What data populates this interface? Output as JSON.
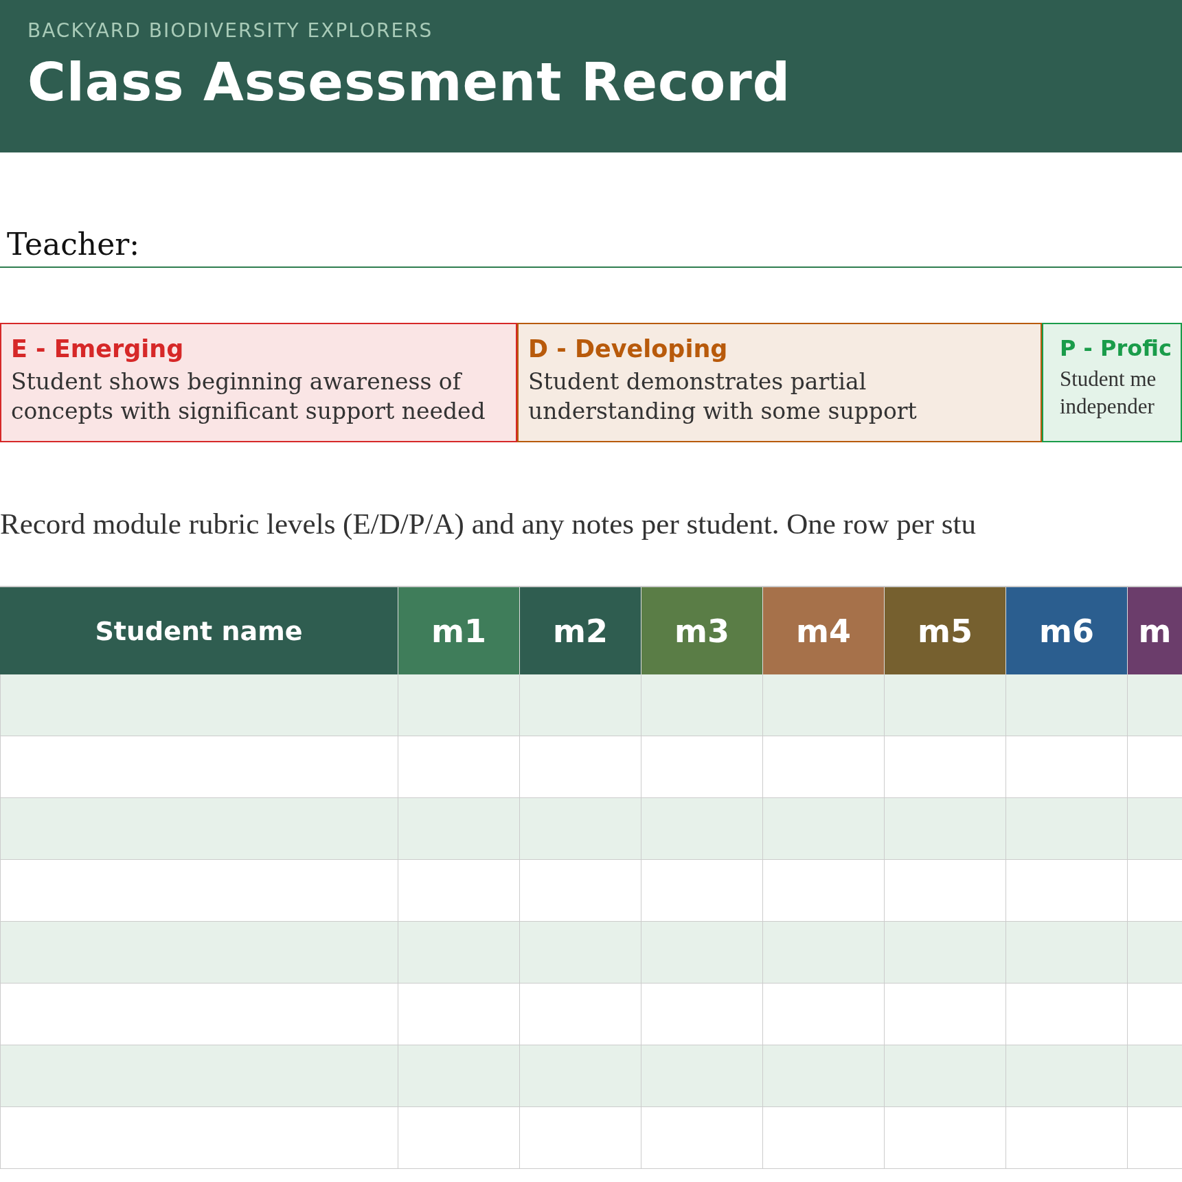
{
  "header": {
    "subtitle": "BACKYARD BIODIVERSITY EXPLORERS",
    "title": "Class Assessment Record"
  },
  "teacher": {
    "label": "Teacher:"
  },
  "legend": [
    {
      "title": "E - Emerging",
      "description": "Student shows beginning awareness of concepts with significant support needed",
      "color": "#d62828"
    },
    {
      "title": "D - Developing",
      "description": "Student demonstrates partial understanding with some support",
      "color": "#b85a0b"
    },
    {
      "title": "P - Profic",
      "description": "Student me independer",
      "color": "#1a9c4a"
    }
  ],
  "instructions": "Record module rubric levels (E/D/P/A) and any notes per student. One row per stu",
  "table": {
    "columns": [
      {
        "label": "Student name",
        "color": "#2f5d50"
      },
      {
        "label": "m1",
        "color": "#3f7d5a"
      },
      {
        "label": "m2",
        "color": "#2f5d50"
      },
      {
        "label": "m3",
        "color": "#5a7d46"
      },
      {
        "label": "m4",
        "color": "#a6714a"
      },
      {
        "label": "m5",
        "color": "#76602f"
      },
      {
        "label": "m6",
        "color": "#2b5e8f"
      },
      {
        "label": "m",
        "color": "#6b3d6b"
      }
    ]
  }
}
